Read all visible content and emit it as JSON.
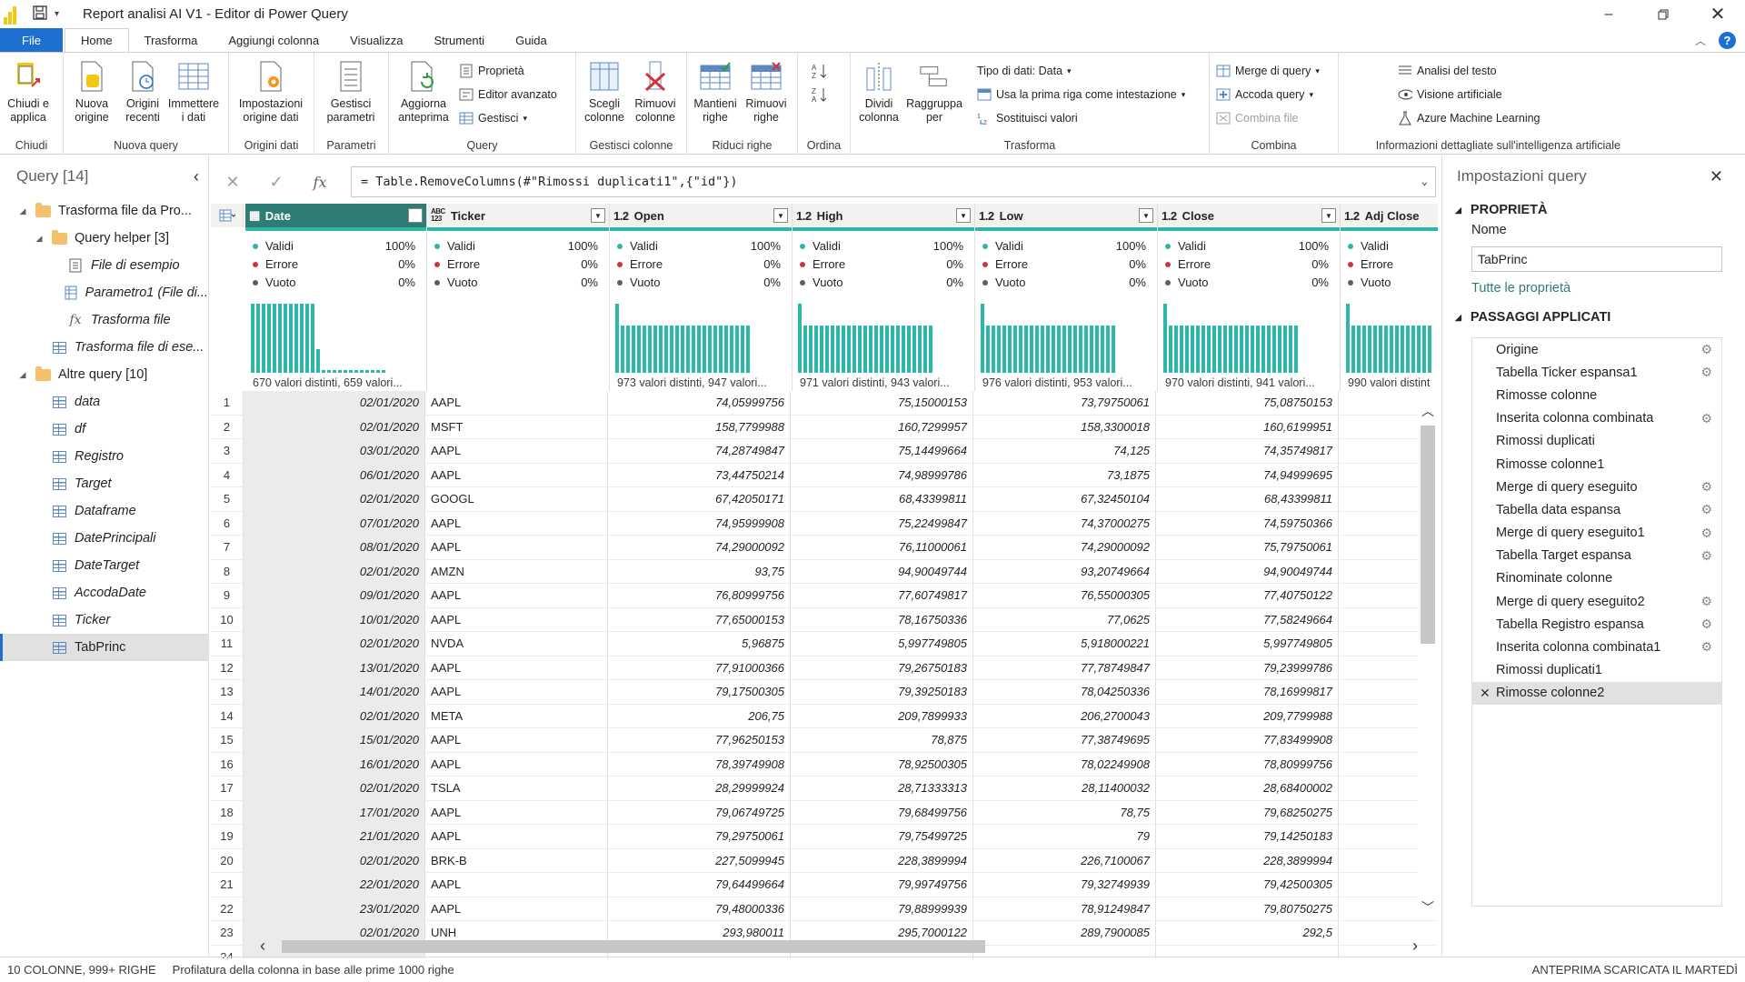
{
  "window": {
    "title": "Report analisi AI V1 - Editor di Power Query"
  },
  "tabs": [
    "File",
    "Home",
    "Trasforma",
    "Aggiungi colonna",
    "Visualizza",
    "Strumenti",
    "Guida"
  ],
  "ribbon": {
    "chiudi": {
      "btn": "Chiudi e\napplica",
      "group": "Chiudi"
    },
    "nuova_query": {
      "nuova": "Nuova\norigine",
      "recenti": "Origini\nrecenti",
      "immettere": "Immettere\ni dati",
      "group": "Nuova query"
    },
    "origini_dati": {
      "impostazioni": "Impostazioni\norigine dati",
      "group": "Origini dati"
    },
    "parametri": {
      "gestisci": "Gestisci\nparametri",
      "group": "Parametri"
    },
    "query": {
      "aggiorna": "Aggiorna\nanteprima",
      "proprieta": "Proprietà",
      "editor": "Editor avanzato",
      "gestisci": "Gestisci",
      "group": "Query"
    },
    "gestisci_colonne": {
      "scegli": "Scegli\ncolonne",
      "rimuovi": "Rimuovi\ncolonne",
      "group": "Gestisci colonne"
    },
    "riduci_righe": {
      "mantieni": "Mantieni\nrighe",
      "rimuovi": "Rimuovi\nrighe",
      "group": "Riduci righe"
    },
    "ordina": {
      "group": "Ordina"
    },
    "trasforma": {
      "dividi": "Dividi\ncolonna",
      "raggruppa": "Raggruppa\nper",
      "tipo": "Tipo di dati: Data",
      "prima_riga": "Usa la prima riga come intestazione",
      "sostituisci": "Sostituisci valori",
      "group": "Trasforma"
    },
    "combina": {
      "merge": "Merge di query",
      "accoda": "Accoda query",
      "combina_file": "Combina file",
      "group": "Combina"
    },
    "ai": {
      "testo": "Analisi del testo",
      "visione": "Visione artificiale",
      "azure": "Azure Machine Learning",
      "group": "Informazioni dettagliate sull'intelligenza artificiale"
    }
  },
  "left_panel": {
    "title": "Query [14]",
    "items": [
      {
        "label": "Trasforma file da Pro...",
        "kind": "folder",
        "indent": 0,
        "tri": "◢",
        "italic": false
      },
      {
        "label": "Query helper [3]",
        "kind": "folder",
        "indent": 1,
        "tri": "◢",
        "italic": false
      },
      {
        "label": "File di esempio",
        "kind": "list",
        "indent": 2,
        "tri": "",
        "italic": true
      },
      {
        "label": "Parametro1 (File di...",
        "kind": "param",
        "indent": 2,
        "tri": "",
        "italic": true
      },
      {
        "label": "Trasforma file",
        "kind": "fx",
        "indent": 2,
        "tri": "",
        "italic": true
      },
      {
        "label": "Trasforma file di ese...",
        "kind": "table",
        "indent": 1,
        "tri": "",
        "italic": true
      },
      {
        "label": "Altre query [10]",
        "kind": "folder",
        "indent": 0,
        "tri": "◢",
        "italic": false
      },
      {
        "label": "data",
        "kind": "table",
        "indent": 1,
        "tri": "",
        "italic": true
      },
      {
        "label": "df",
        "kind": "table",
        "indent": 1,
        "tri": "",
        "italic": true
      },
      {
        "label": "Registro",
        "kind": "table",
        "indent": 1,
        "tri": "",
        "italic": true
      },
      {
        "label": "Target",
        "kind": "table",
        "indent": 1,
        "tri": "",
        "italic": true
      },
      {
        "label": "Dataframe",
        "kind": "table",
        "indent": 1,
        "tri": "",
        "italic": true
      },
      {
        "label": "DatePrincipali",
        "kind": "table",
        "indent": 1,
        "tri": "",
        "italic": true
      },
      {
        "label": "DateTarget",
        "kind": "table",
        "indent": 1,
        "tri": "",
        "italic": true
      },
      {
        "label": "AccodaDate",
        "kind": "table",
        "indent": 1,
        "tri": "",
        "italic": true
      },
      {
        "label": "Ticker",
        "kind": "table",
        "indent": 1,
        "tri": "",
        "italic": true
      },
      {
        "label": "TabPrinc",
        "kind": "table",
        "indent": 1,
        "tri": "",
        "italic": false,
        "selected": true
      }
    ]
  },
  "formula": "= Table.RemoveColumns(#\"Rimossi duplicati1\",{\"id\"})",
  "profile_labels": {
    "valid": "Validi",
    "error": "Errore",
    "empty": "Vuoto"
  },
  "columns": [
    {
      "type": "▦",
      "name": "Date",
      "valid": "100%",
      "error": "0%",
      "empty": "0%",
      "distinct": "670 valori distinti, 659 valori...",
      "hist": "date",
      "width": 200
    },
    {
      "type": "ABC\n123",
      "name": "Ticker",
      "valid": "100%",
      "error": "0%",
      "empty": "0%",
      "distinct": "",
      "hist": "none",
      "width": 201
    },
    {
      "type": "1.2",
      "name": "Open",
      "valid": "100%",
      "error": "0%",
      "empty": "0%",
      "distinct": "973 valori distinti, 947 valori...",
      "hist": "flat",
      "width": 201
    },
    {
      "type": "1.2",
      "name": "High",
      "valid": "100%",
      "error": "0%",
      "empty": "0%",
      "distinct": "971 valori distinti, 943 valori...",
      "hist": "flat",
      "width": 201
    },
    {
      "type": "1.2",
      "name": "Low",
      "valid": "100%",
      "error": "0%",
      "empty": "0%",
      "distinct": "976 valori distinti, 953 valori...",
      "hist": "flat",
      "width": 201
    },
    {
      "type": "1.2",
      "name": "Close",
      "valid": "100%",
      "error": "0%",
      "empty": "0%",
      "distinct": "970 valori distinti, 941 valori...",
      "hist": "flat",
      "width": 201
    },
    {
      "type": "1.2",
      "name": "Adj Close",
      "valid": "",
      "error": "",
      "empty": "",
      "distinct": "990 valori distint",
      "hist": "flat",
      "width": 110
    }
  ],
  "rows": [
    [
      "1",
      "02/01/2020",
      "AAPL",
      "74,05999756",
      "75,15000153",
      "73,79750061",
      "75,08750153"
    ],
    [
      "2",
      "02/01/2020",
      "MSFT",
      "158,7799988",
      "160,7299957",
      "158,3300018",
      "160,6199951"
    ],
    [
      "3",
      "03/01/2020",
      "AAPL",
      "74,28749847",
      "75,14499664",
      "74,125",
      "74,35749817"
    ],
    [
      "4",
      "06/01/2020",
      "AAPL",
      "73,44750214",
      "74,98999786",
      "73,1875",
      "74,94999695"
    ],
    [
      "5",
      "02/01/2020",
      "GOOGL",
      "67,42050171",
      "68,43399811",
      "67,32450104",
      "68,43399811"
    ],
    [
      "6",
      "07/01/2020",
      "AAPL",
      "74,95999908",
      "75,22499847",
      "74,37000275",
      "74,59750366"
    ],
    [
      "7",
      "08/01/2020",
      "AAPL",
      "74,29000092",
      "76,11000061",
      "74,29000092",
      "75,79750061"
    ],
    [
      "8",
      "02/01/2020",
      "AMZN",
      "93,75",
      "94,90049744",
      "93,20749664",
      "94,90049744"
    ],
    [
      "9",
      "09/01/2020",
      "AAPL",
      "76,80999756",
      "77,60749817",
      "76,55000305",
      "77,40750122"
    ],
    [
      "10",
      "10/01/2020",
      "AAPL",
      "77,65000153",
      "78,16750336",
      "77,0625",
      "77,58249664"
    ],
    [
      "11",
      "02/01/2020",
      "NVDA",
      "5,96875",
      "5,997749805",
      "5,918000221",
      "5,997749805"
    ],
    [
      "12",
      "13/01/2020",
      "AAPL",
      "77,91000366",
      "79,26750183",
      "77,78749847",
      "79,23999786"
    ],
    [
      "13",
      "14/01/2020",
      "AAPL",
      "79,17500305",
      "79,39250183",
      "78,04250336",
      "78,16999817"
    ],
    [
      "14",
      "02/01/2020",
      "META",
      "206,75",
      "209,7899933",
      "206,2700043",
      "209,7799988"
    ],
    [
      "15",
      "15/01/2020",
      "AAPL",
      "77,96250153",
      "78,875",
      "77,38749695",
      "77,83499908"
    ],
    [
      "16",
      "16/01/2020",
      "AAPL",
      "78,39749908",
      "78,92500305",
      "78,02249908",
      "78,80999756"
    ],
    [
      "17",
      "02/01/2020",
      "TSLA",
      "28,29999924",
      "28,71333313",
      "28,11400032",
      "28,68400002"
    ],
    [
      "18",
      "17/01/2020",
      "AAPL",
      "79,06749725",
      "79,68499756",
      "78,75",
      "79,68250275"
    ],
    [
      "19",
      "21/01/2020",
      "AAPL",
      "79,29750061",
      "79,75499725",
      "79",
      "79,14250183"
    ],
    [
      "20",
      "02/01/2020",
      "BRK-B",
      "227,5099945",
      "228,3899994",
      "226,7100067",
      "228,3899994"
    ],
    [
      "21",
      "22/01/2020",
      "AAPL",
      "79,64499664",
      "79,99749756",
      "79,32749939",
      "79,42500305"
    ],
    [
      "22",
      "23/01/2020",
      "AAPL",
      "79,48000336",
      "79,88999939",
      "78,91249847",
      "79,80750275"
    ],
    [
      "23",
      "02/01/2020",
      "UNH",
      "293,980011",
      "295,7000122",
      "289,7900085",
      "292,5"
    ],
    [
      "24",
      "",
      "",
      "",
      "",
      "",
      ""
    ]
  ],
  "right_panel": {
    "title": "Impostazioni query",
    "properties": "PROPRIETÀ",
    "name_label": "Nome",
    "name_value": "TabPrinc",
    "all_props": "Tutte le proprietà",
    "steps_title": "PASSAGGI APPLICATI",
    "steps": [
      {
        "label": "Origine",
        "gear": true
      },
      {
        "label": "Tabella Ticker espansa1",
        "gear": true
      },
      {
        "label": "Rimosse colonne",
        "gear": false
      },
      {
        "label": "Inserita colonna combinata",
        "gear": true
      },
      {
        "label": "Rimossi duplicati",
        "gear": false
      },
      {
        "label": "Rimosse colonne1",
        "gear": false
      },
      {
        "label": "Merge di query eseguito",
        "gear": true
      },
      {
        "label": "Tabella data espansa",
        "gear": true
      },
      {
        "label": "Merge di query eseguito1",
        "gear": true
      },
      {
        "label": "Tabella Target espansa",
        "gear": true
      },
      {
        "label": "Rinominate colonne",
        "gear": false
      },
      {
        "label": "Merge di query eseguito2",
        "gear": true
      },
      {
        "label": "Tabella Registro espansa",
        "gear": true
      },
      {
        "label": "Inserita colonna combinata1",
        "gear": true
      },
      {
        "label": "Rimossi duplicati1",
        "gear": false
      },
      {
        "label": "Rimosse colonne2",
        "gear": false,
        "selected": true
      }
    ]
  },
  "status": {
    "cols_rows": "10 COLONNE, 999+ RIGHE",
    "profiling": "Profilatura della colonna in base alle prime 1000 righe",
    "preview": "ANTEPRIMA SCARICATA IL MARTEDÌ"
  },
  "colors": {
    "accent": "#1d6fd0",
    "teal": "#2db7a9",
    "teal_dark": "#2e7d74"
  }
}
